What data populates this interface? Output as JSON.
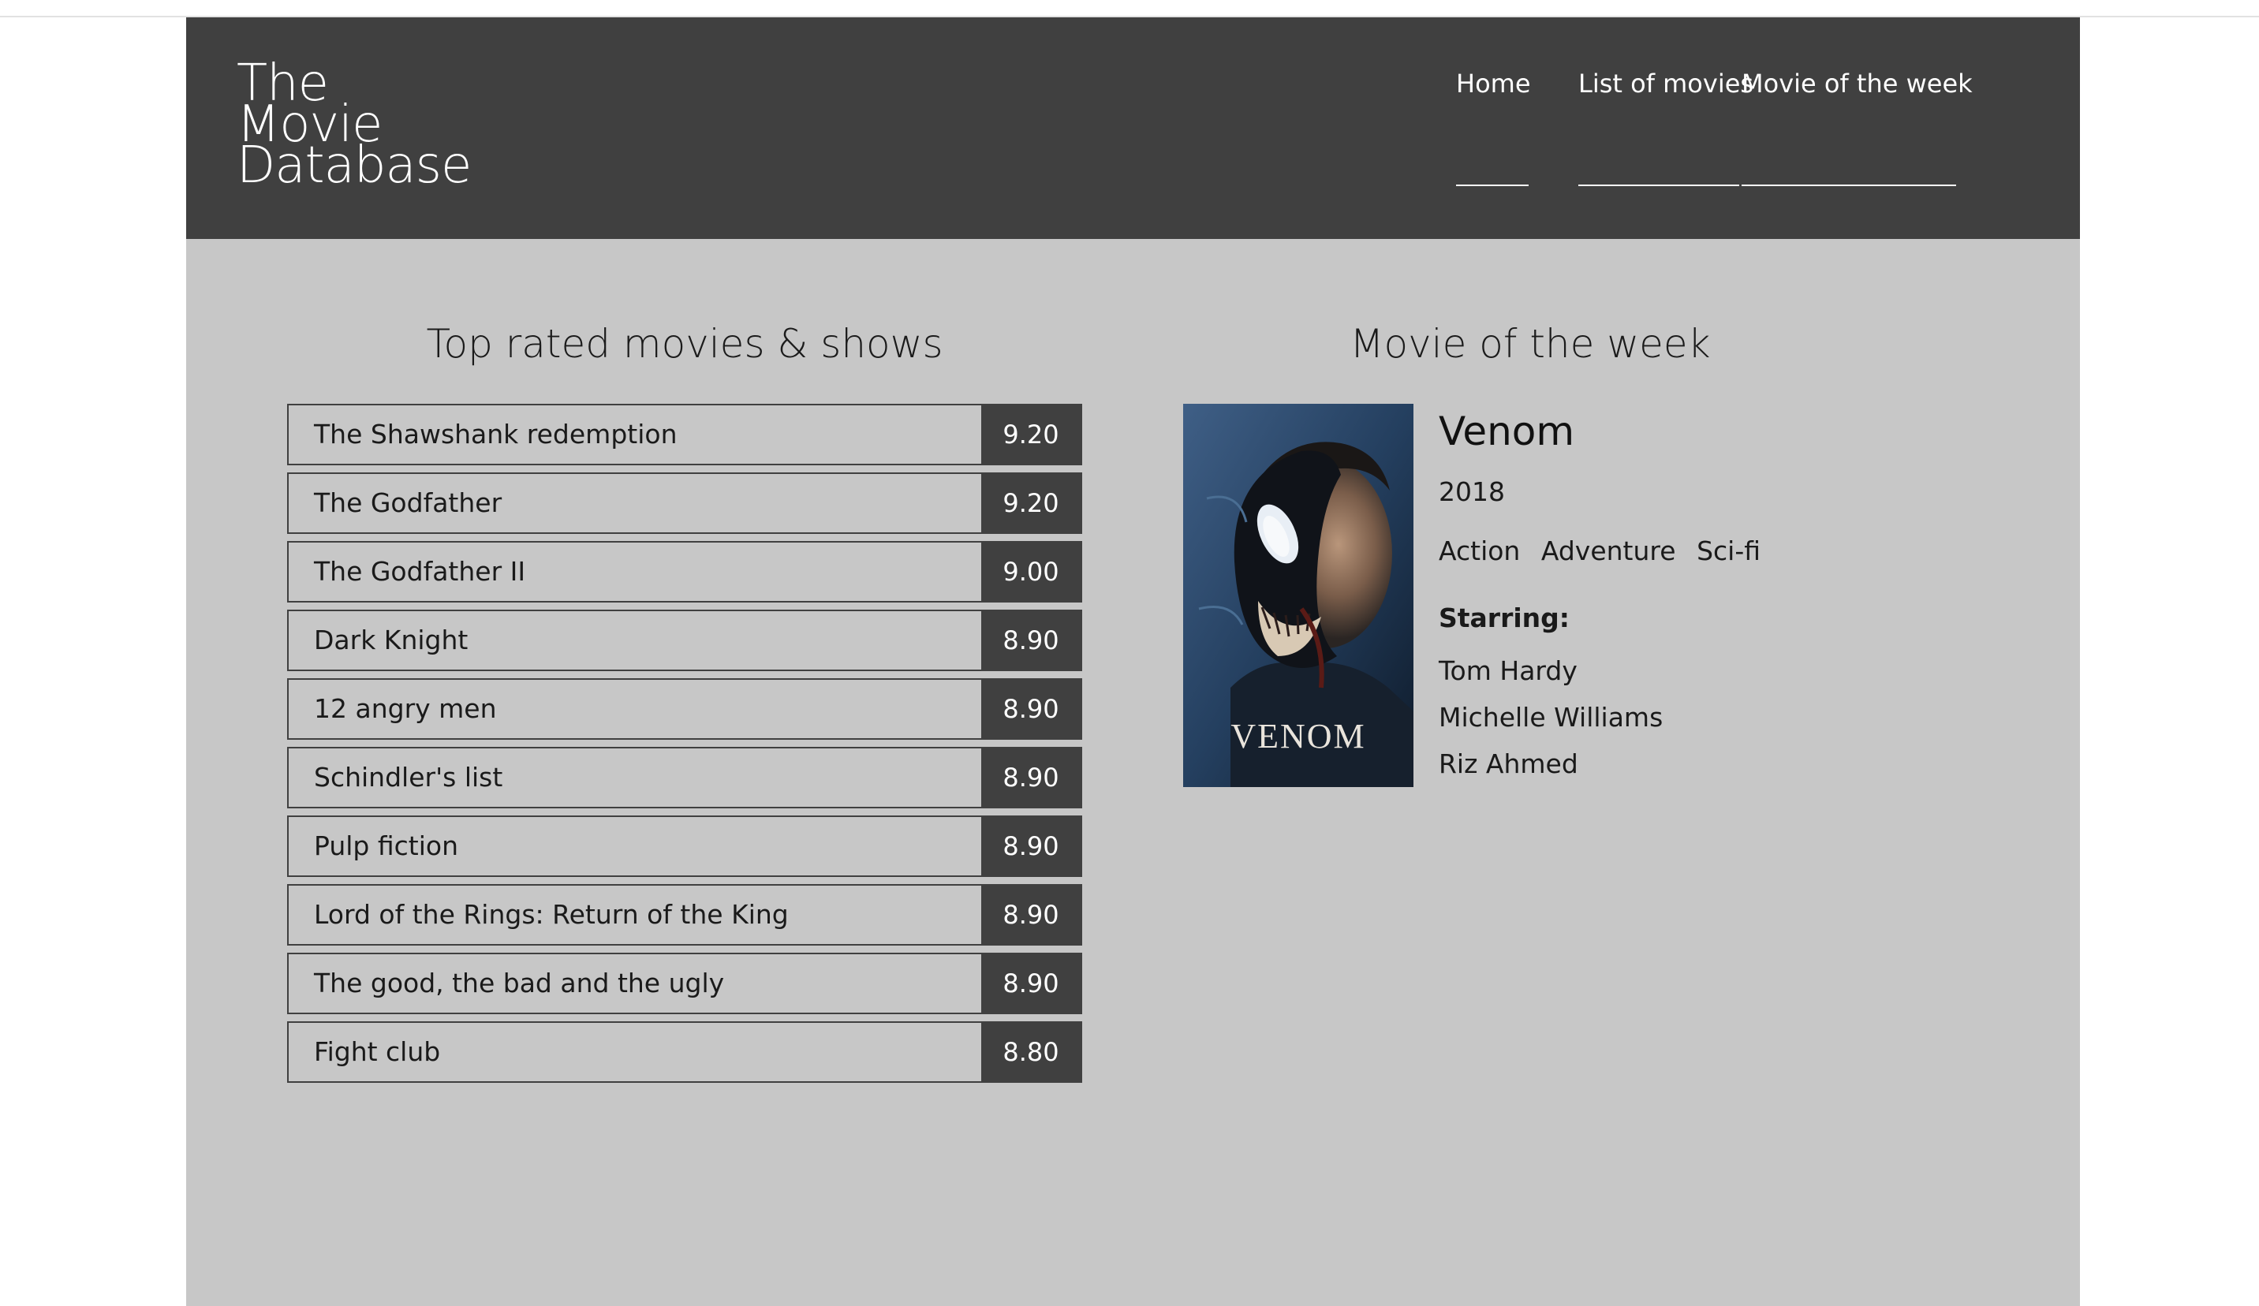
{
  "site": {
    "logo_lines": [
      "The",
      "Movie",
      "Database"
    ],
    "nav": [
      "Home",
      "List of movies",
      "Movie of the week"
    ]
  },
  "top_rated": {
    "title": "Top rated movies & shows",
    "movies": [
      {
        "title": "The Shawshank redemption",
        "score": "9.20"
      },
      {
        "title": "The Godfather",
        "score": "9.20"
      },
      {
        "title": "The Godfather II",
        "score": "9.00"
      },
      {
        "title": "Dark Knight",
        "score": "8.90"
      },
      {
        "title": "12 angry men",
        "score": "8.90"
      },
      {
        "title": "Schindler's list",
        "score": "8.90"
      },
      {
        "title": "Pulp fiction",
        "score": "8.90"
      },
      {
        "title": "Lord of the Rings: Return of the King",
        "score": "8.90"
      },
      {
        "title": "The good, the bad and the ugly",
        "score": "8.90"
      },
      {
        "title": "Fight club",
        "score": "8.80"
      }
    ]
  },
  "movie_of_week": {
    "section_title": "Movie of the week",
    "title": "Venom",
    "year": "2018",
    "genres": [
      "Action",
      "Adventure",
      "Sci-fi"
    ],
    "starring_label": "Starring:",
    "cast": [
      "Tom Hardy",
      "Michelle Williams",
      "Riz Ahmed"
    ],
    "poster_text": "VENOM"
  },
  "colors": {
    "header_bg": "#404040",
    "page_bg": "#c7c7c7",
    "score_bg": "#404040",
    "white": "#ffffff"
  }
}
